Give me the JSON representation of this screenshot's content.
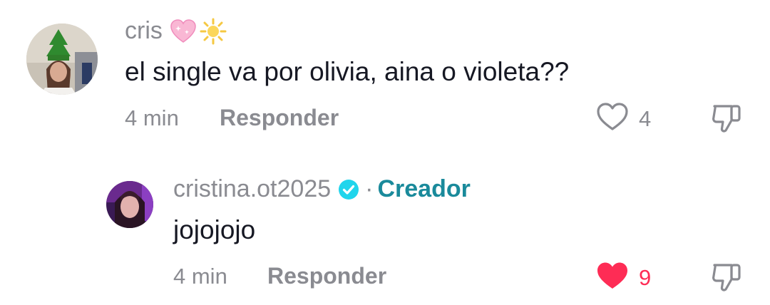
{
  "comments": [
    {
      "username": "cris",
      "username_emojis": [
        "sparkling-heart-icon",
        "sun-icon"
      ],
      "text": "el single va por olivia, aina o violeta??",
      "time": "4 min",
      "reply_label": "Responder",
      "likes": "4",
      "liked": false
    },
    {
      "username": "cristina.ot2025",
      "verified": true,
      "separator": "·",
      "creator_label": "Creador",
      "text": "jojojojo",
      "time": "4 min",
      "reply_label": "Responder",
      "likes": "9",
      "liked": true
    }
  ],
  "colors": {
    "muted_text": "#8a8b91",
    "primary_text": "#161823",
    "creator": "#1a8a9b",
    "verified": "#20d5ec",
    "liked_heart": "#fe2c55"
  }
}
